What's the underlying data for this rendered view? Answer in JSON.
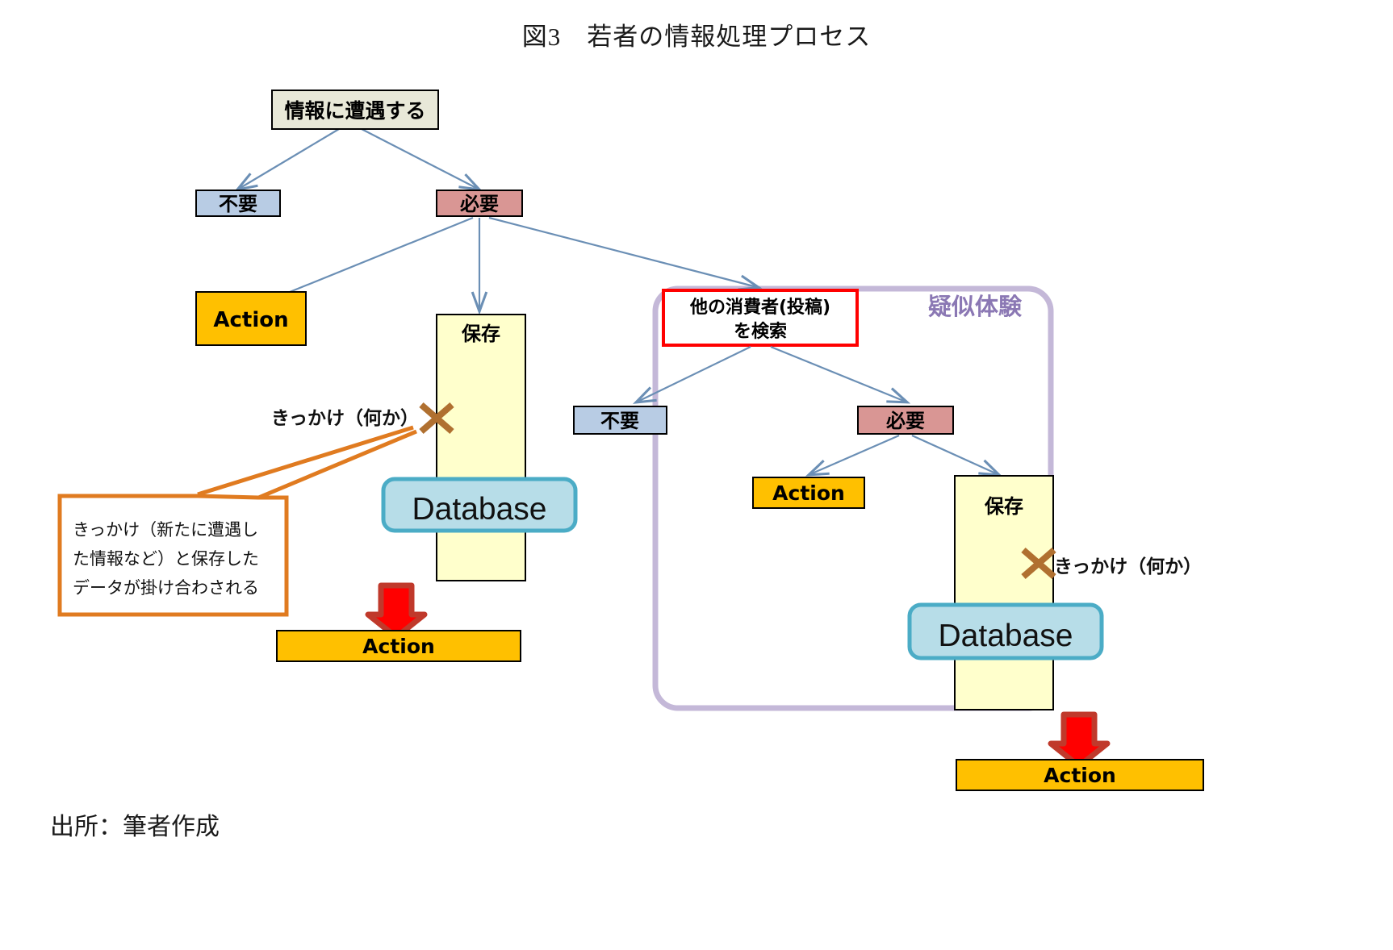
{
  "figure": {
    "title": "図3　若者の情報処理プロセス",
    "source_note": "出所：筆者作成"
  },
  "nodes": {
    "encounter": "情報に遭遇する",
    "left_unnecessary": "不要",
    "left_necessary": "必要",
    "left_action_top": "Action",
    "left_store": "保存",
    "left_database": "Database",
    "left_action_bottom": "Action",
    "search_others": "他の消費者(投稿)\nを検索",
    "search_others_line1": "他の消費者(投稿)",
    "search_others_line2": "を検索",
    "right_unnecessary": "不要",
    "right_necessary": "必要",
    "right_action_top": "Action",
    "right_store": "保存",
    "right_database": "Database",
    "right_action_bottom": "Action",
    "pseudo_experience": "疑似体験"
  },
  "annotations": {
    "trigger_left": "きっかけ（何か）",
    "trigger_right": "きっかけ（何か）",
    "callout_lines": [
      "きっかけ（新たに遭遇し",
      "た情報など）と保存した",
      "データが掛け合わされる"
    ]
  },
  "colors": {
    "encounter_fill": "#e8e8d8",
    "unnecessary_fill": "#b8cce4",
    "necessary_fill": "#d99694",
    "action_fill": "#ffc000",
    "store_fill": "#ffffcc",
    "database_fill": "#b7dde8",
    "database_border": "#4bacc6",
    "arrow_stroke": "#6b8fb5",
    "red_border": "#ff0000",
    "red_arrow": "#ff0000",
    "red_arrow_edge": "#c0392b",
    "callout_border": "#e07b20",
    "cross_mark": "#b07030",
    "pseudo_border": "#c4b8d8",
    "pseudo_text": "#8b78b4",
    "box_border": "#000000"
  }
}
